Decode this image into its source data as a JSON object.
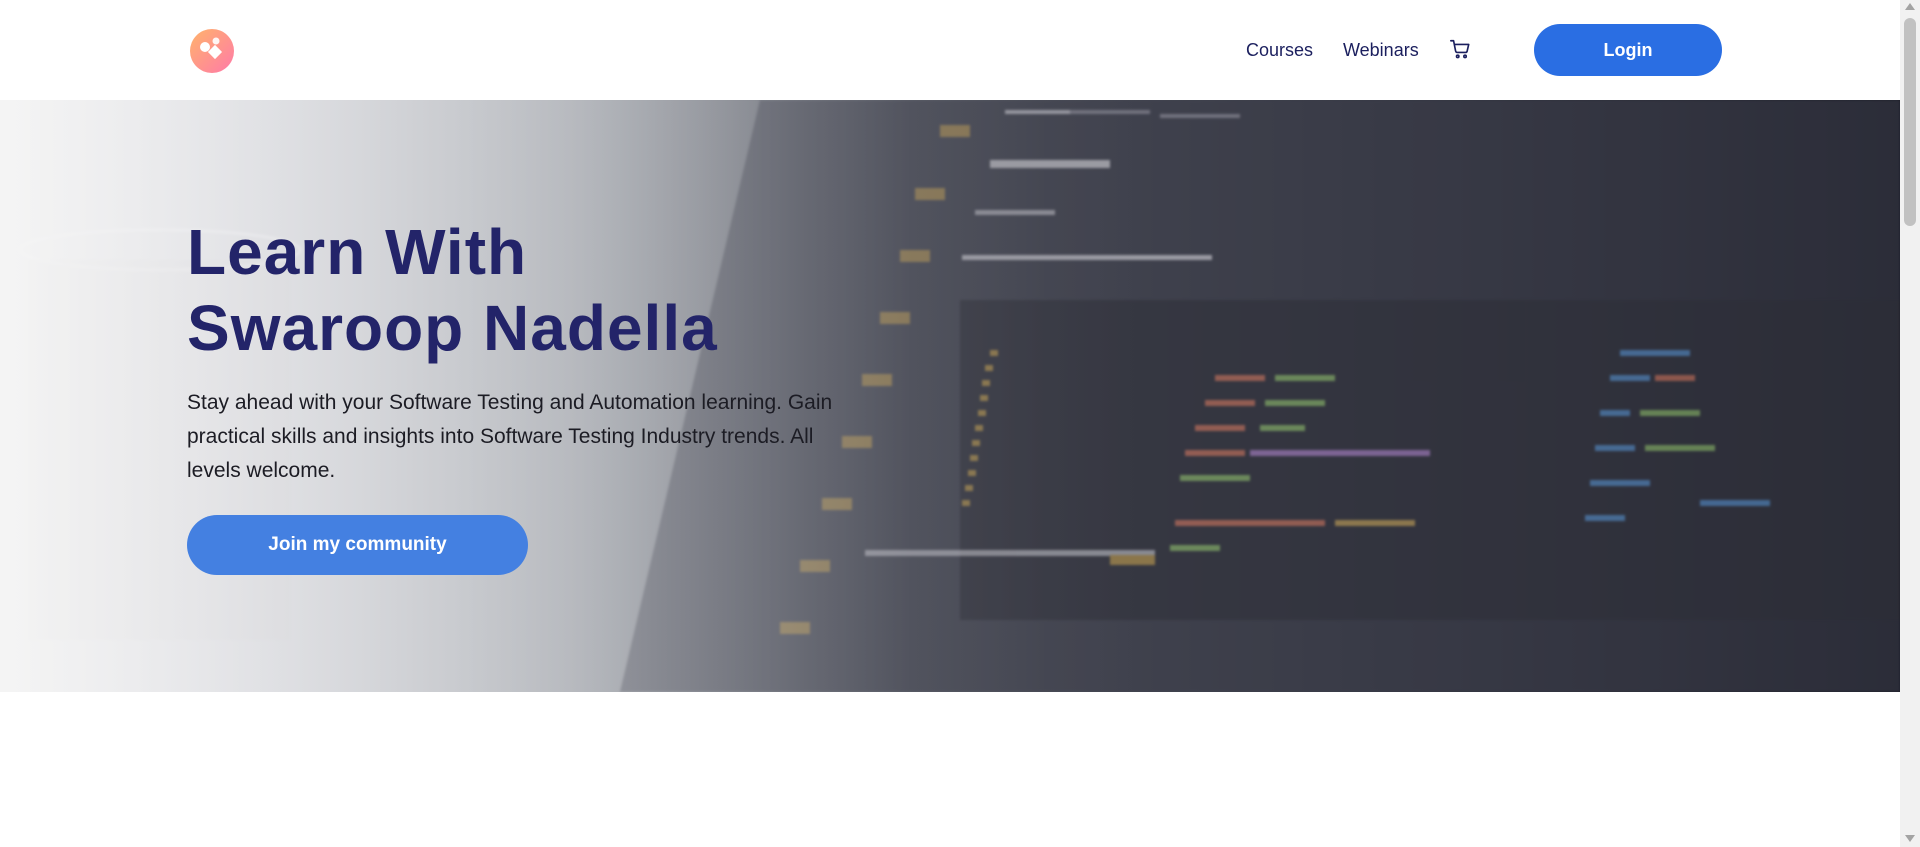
{
  "header": {
    "logo_icon": "brand-logo-icon",
    "nav": {
      "courses": "Courses",
      "webinars": "Webinars",
      "cart_icon": "cart-icon"
    },
    "login_label": "Login"
  },
  "hero": {
    "title_line1": "Learn With",
    "title_line2": "Swaroop Nadella",
    "subtitle": "Stay ahead with your Software Testing and Automation learning. Gain practical skills and insights into Software Testing Industry trends. All levels welcome.",
    "cta_label": "Join my community",
    "background_image": "blurred-code-editor-screenshot"
  },
  "colors": {
    "primary_button": "#2a6ee3",
    "cta_button": "#4480e1",
    "title": "#232469",
    "nav_text": "#1b1f5e"
  }
}
